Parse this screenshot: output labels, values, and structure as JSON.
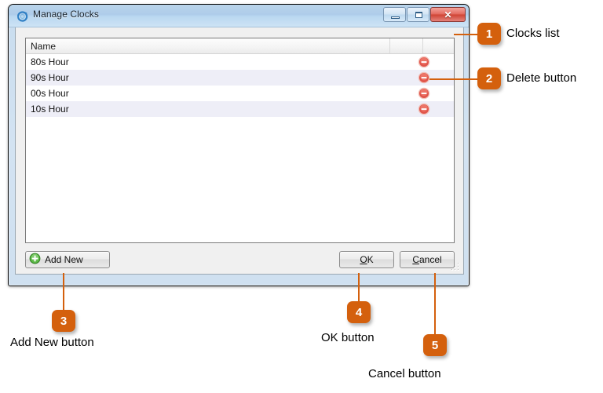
{
  "window": {
    "title": "Manage Clocks",
    "icon": "clock-icon",
    "controls": {
      "minimize": "minimize-icon",
      "maximize": "maximize-icon",
      "close": "✕"
    }
  },
  "list": {
    "columns": [
      "Name",
      "",
      ""
    ],
    "rows": [
      {
        "name": "80s Hour",
        "delete_icon": "delete-icon"
      },
      {
        "name": "90s Hour",
        "delete_icon": "delete-icon"
      },
      {
        "name": "00s Hour",
        "delete_icon": "delete-icon"
      },
      {
        "name": "10s Hour",
        "delete_icon": "delete-icon"
      }
    ]
  },
  "buttons": {
    "add_new": {
      "label": "Add New",
      "icon": "add-plus-icon"
    },
    "ok": {
      "prefix": "",
      "accel": "O",
      "suffix": "K"
    },
    "cancel": {
      "prefix": "",
      "accel": "C",
      "suffix": "ancel"
    }
  },
  "annotations": [
    {
      "number": "1",
      "label": "Clocks list"
    },
    {
      "number": "2",
      "label": "Delete button"
    },
    {
      "number": "3",
      "label": "Add New button"
    },
    {
      "number": "4",
      "label": "OK button"
    },
    {
      "number": "5",
      "label": "Cancel button"
    }
  ],
  "colors": {
    "accent": "#d4600d",
    "delete": "#e04a3a",
    "add": "#4caf35",
    "title_text": "#16212b"
  }
}
